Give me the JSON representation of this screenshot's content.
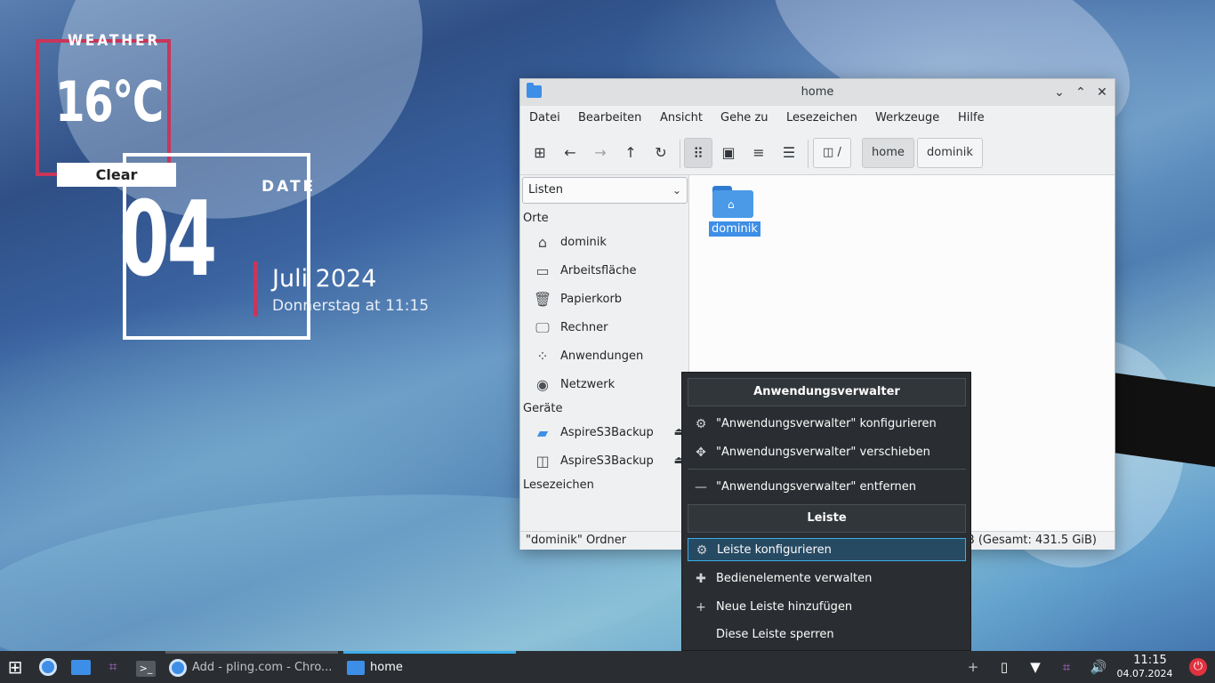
{
  "weather": {
    "title": "WEATHER",
    "temperature": "16°C",
    "condition": "Clear"
  },
  "date_widget": {
    "title": "DATE",
    "day": "04",
    "month_year": "Juli 2024",
    "subtitle": "Donnerstag at 11:15"
  },
  "window": {
    "title": "home",
    "menu": [
      "Datei",
      "Bearbeiten",
      "Ansicht",
      "Gehe zu",
      "Lesezeichen",
      "Werkzeuge",
      "Hilfe"
    ],
    "breadcrumb": {
      "root": "/",
      "items": [
        "home",
        "dominik"
      ]
    },
    "sidebar": {
      "view_combo": "Listen",
      "places_header": "Orte",
      "places": [
        {
          "label": "dominik",
          "icon": "home-icon"
        },
        {
          "label": "Arbeitsfläche",
          "icon": "desktop-icon"
        },
        {
          "label": "Papierkorb",
          "icon": "trash-icon"
        },
        {
          "label": "Rechner",
          "icon": "computer-icon"
        },
        {
          "label": "Anwendungen",
          "icon": "apps-icon"
        },
        {
          "label": "Netzwerk",
          "icon": "network-icon"
        }
      ],
      "devices_header": "Geräte",
      "devices": [
        {
          "label": "AspireS3Backup",
          "icon": "drive-icon"
        },
        {
          "label": "AspireS3Backup",
          "icon": "disk-icon"
        }
      ],
      "bookmarks_header": "Lesezeichen"
    },
    "content": {
      "folders": [
        {
          "label": "dominik"
        }
      ]
    },
    "status": {
      "left": "\"dominik\" Ordner",
      "right": "B (Gesamt: 431.5 GiB)"
    }
  },
  "context_menu": {
    "header1": "Anwendungsverwalter",
    "items1": [
      {
        "label": "\"Anwendungsverwalter\" konfigurieren",
        "icon": "gear-icon"
      },
      {
        "label": "\"Anwendungsverwalter\" verschieben",
        "icon": "move-icon"
      },
      {
        "label": "\"Anwendungsverwalter\" entfernen",
        "icon": "minus-icon"
      }
    ],
    "header2": "Leiste",
    "items2": [
      {
        "label": "Leiste konfigurieren",
        "icon": "gear-icon"
      },
      {
        "label": "Bedienelemente verwalten",
        "icon": "puzzle-icon"
      },
      {
        "label": "Neue Leiste hinzufügen",
        "icon": "plus-icon"
      },
      {
        "label": "Diese Leiste sperren",
        "icon": ""
      }
    ]
  },
  "taskbar": {
    "tasks": [
      {
        "label": "Add - pling.com - Chro..."
      },
      {
        "label": "home"
      }
    ],
    "clock": {
      "time": "11:15",
      "date": "04.07.2024"
    }
  },
  "colors": {
    "accent": "#3d8ee6",
    "widget_red": "#c8365a",
    "panel": "#2a2e32"
  }
}
